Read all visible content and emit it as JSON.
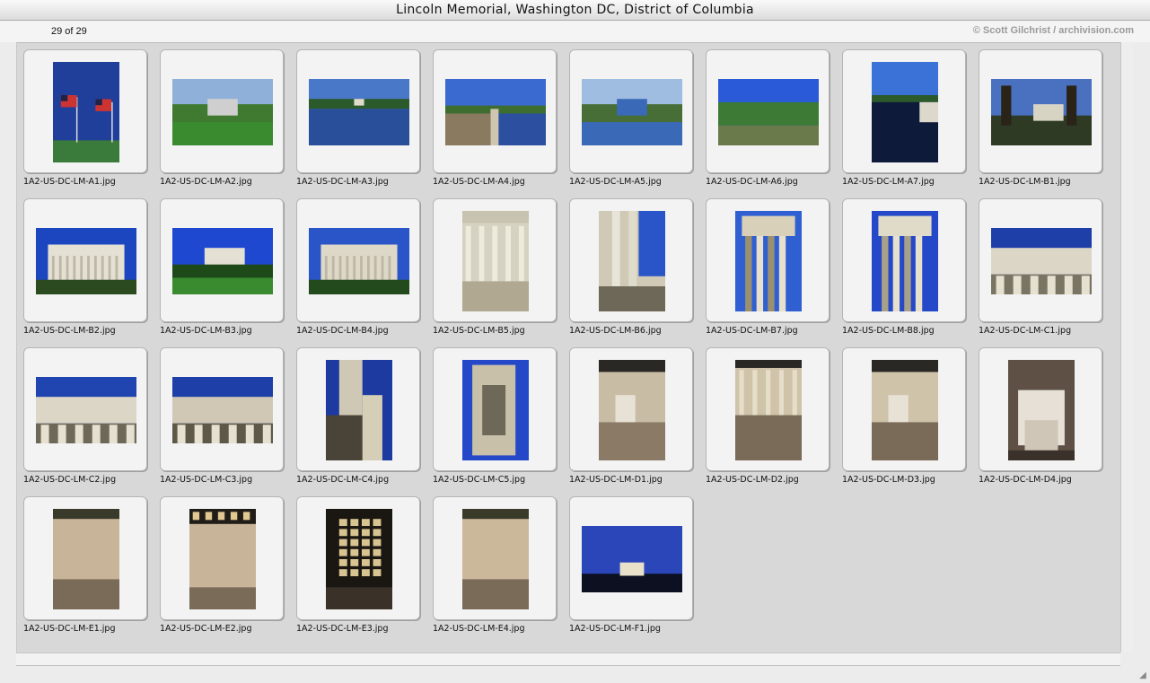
{
  "window": {
    "title": "Lincoln Memorial, Washington DC, District of Columbia"
  },
  "info": {
    "count": "29 of 29",
    "credit": "© Scott Gilchrist / archivision.com"
  },
  "thumbnails": [
    {
      "file": "1A2-US-DC-LM-A1.jpg",
      "orientation": "portrait",
      "scene": "flags",
      "colors": [
        "#1f3f9a",
        "#2f5ec0",
        "#3a7a3a"
      ]
    },
    {
      "file": "1A2-US-DC-LM-A2.jpg",
      "orientation": "landscape",
      "scene": "memorial-pool",
      "colors": [
        "#8fb0d8",
        "#3f7a30",
        "#cfcfcf"
      ]
    },
    {
      "file": "1A2-US-DC-LM-A3.jpg",
      "orientation": "landscape",
      "scene": "reflecting-pool",
      "colors": [
        "#4a78c8",
        "#2b5a2b",
        "#2a4f9a"
      ]
    },
    {
      "file": "1A2-US-DC-LM-A4.jpg",
      "orientation": "landscape",
      "scene": "reflecting-pool-path",
      "colors": [
        "#3a6ad0",
        "#3d6e30",
        "#2c4fa0"
      ]
    },
    {
      "file": "1A2-US-DC-LM-A5.jpg",
      "orientation": "landscape",
      "scene": "memorial-pool",
      "colors": [
        "#9fbde0",
        "#476e36",
        "#3a69b8"
      ]
    },
    {
      "file": "1A2-US-DC-LM-A6.jpg",
      "orientation": "landscape",
      "scene": "trees-water",
      "colors": [
        "#2a5ad8",
        "#3c7a36",
        "#6a7a4a"
      ]
    },
    {
      "file": "1A2-US-DC-LM-A7.jpg",
      "orientation": "portrait",
      "scene": "long-pool",
      "colors": [
        "#3a72d8",
        "#0e1a3a",
        "#2b5a2b"
      ]
    },
    {
      "file": "1A2-US-DC-LM-B1.jpg",
      "orientation": "landscape",
      "scene": "trees-memorial",
      "colors": [
        "#4a70c0",
        "#2e3a24",
        "#d8d4c4"
      ]
    },
    {
      "file": "1A2-US-DC-LM-B2.jpg",
      "orientation": "landscape",
      "scene": "memorial-front",
      "colors": [
        "#1c46c0",
        "#e4e0d4",
        "#2b4a20"
      ]
    },
    {
      "file": "1A2-US-DC-LM-B3.jpg",
      "orientation": "landscape",
      "scene": "memorial-lawn",
      "colors": [
        "#1f48d0",
        "#3a8a30",
        "#e4e0d4"
      ]
    },
    {
      "file": "1A2-US-DC-LM-B4.jpg",
      "orientation": "landscape",
      "scene": "memorial-front",
      "colors": [
        "#2a55c8",
        "#ddd8c8",
        "#234a1c"
      ]
    },
    {
      "file": "1A2-US-DC-LM-B5.jpg",
      "orientation": "portrait",
      "scene": "columns-steps",
      "colors": [
        "#d6d2c2",
        "#8a8270",
        "#b0a890"
      ]
    },
    {
      "file": "1A2-US-DC-LM-B6.jpg",
      "orientation": "portrait",
      "scene": "colonnade",
      "colors": [
        "#2a55c8",
        "#cfc9b6",
        "#6e6858"
      ]
    },
    {
      "file": "1A2-US-DC-LM-B7.jpg",
      "orientation": "portrait",
      "scene": "column-corner",
      "colors": [
        "#2f5fd0",
        "#d8d0b8",
        "#9a9070"
      ]
    },
    {
      "file": "1A2-US-DC-LM-B8.jpg",
      "orientation": "portrait",
      "scene": "column-corner",
      "colors": [
        "#2448c8",
        "#e0dac8",
        "#a8a088"
      ]
    },
    {
      "file": "1A2-US-DC-LM-C1.jpg",
      "orientation": "landscape",
      "scene": "frieze",
      "colors": [
        "#1f3fa8",
        "#dcd6c6",
        "#7a7462"
      ]
    },
    {
      "file": "1A2-US-DC-LM-C2.jpg",
      "orientation": "landscape",
      "scene": "frieze",
      "colors": [
        "#2145b0",
        "#dcd6c6",
        "#6e6858"
      ]
    },
    {
      "file": "1A2-US-DC-LM-C3.jpg",
      "orientation": "landscape",
      "scene": "frieze",
      "colors": [
        "#1f3fa8",
        "#d0c8b4",
        "#5e5848"
      ]
    },
    {
      "file": "1A2-US-DC-LM-C4.jpg",
      "orientation": "portrait",
      "scene": "stair-corner",
      "colors": [
        "#1c3aa0",
        "#cfc8b4",
        "#4a4438"
      ]
    },
    {
      "file": "1A2-US-DC-LM-C5.jpg",
      "orientation": "portrait",
      "scene": "tripod",
      "colors": [
        "#2448c8",
        "#c8c0a8",
        "#6e6858"
      ]
    },
    {
      "file": "1A2-US-DC-LM-D1.jpg",
      "orientation": "portrait",
      "scene": "interior-statue",
      "colors": [
        "#2a2824",
        "#c8bca4",
        "#8a7a66"
      ]
    },
    {
      "file": "1A2-US-DC-LM-D2.jpg",
      "orientation": "portrait",
      "scene": "interior-hall",
      "colors": [
        "#2a2824",
        "#cfc3aa",
        "#7a6a58"
      ]
    },
    {
      "file": "1A2-US-DC-LM-D3.jpg",
      "orientation": "portrait",
      "scene": "interior-statue",
      "colors": [
        "#2a2824",
        "#cfc3aa",
        "#7a6a58"
      ]
    },
    {
      "file": "1A2-US-DC-LM-D4.jpg",
      "orientation": "portrait",
      "scene": "statue-closeup",
      "colors": [
        "#5e5044",
        "#e6e0d6",
        "#3a322a"
      ]
    },
    {
      "file": "1A2-US-DC-LM-E1.jpg",
      "orientation": "portrait",
      "scene": "inscription-wall",
      "colors": [
        "#3a3a2a",
        "#c8b498",
        "#7a6a58"
      ]
    },
    {
      "file": "1A2-US-DC-LM-E2.jpg",
      "orientation": "portrait",
      "scene": "ceiling-wall",
      "colors": [
        "#201c18",
        "#c8b498",
        "#7a6a58"
      ]
    },
    {
      "file": "1A2-US-DC-LM-E3.jpg",
      "orientation": "portrait",
      "scene": "ceiling-grid",
      "colors": [
        "#1a1612",
        "#d8c490",
        "#3a3228"
      ]
    },
    {
      "file": "1A2-US-DC-LM-E4.jpg",
      "orientation": "portrait",
      "scene": "inscription-wall",
      "colors": [
        "#3a3a2a",
        "#cbb79a",
        "#7a6a58"
      ]
    },
    {
      "file": "1A2-US-DC-LM-F1.jpg",
      "orientation": "landscape",
      "scene": "dusk",
      "colors": [
        "#2a46b8",
        "#0c1020",
        "#e8e0c8"
      ]
    }
  ]
}
